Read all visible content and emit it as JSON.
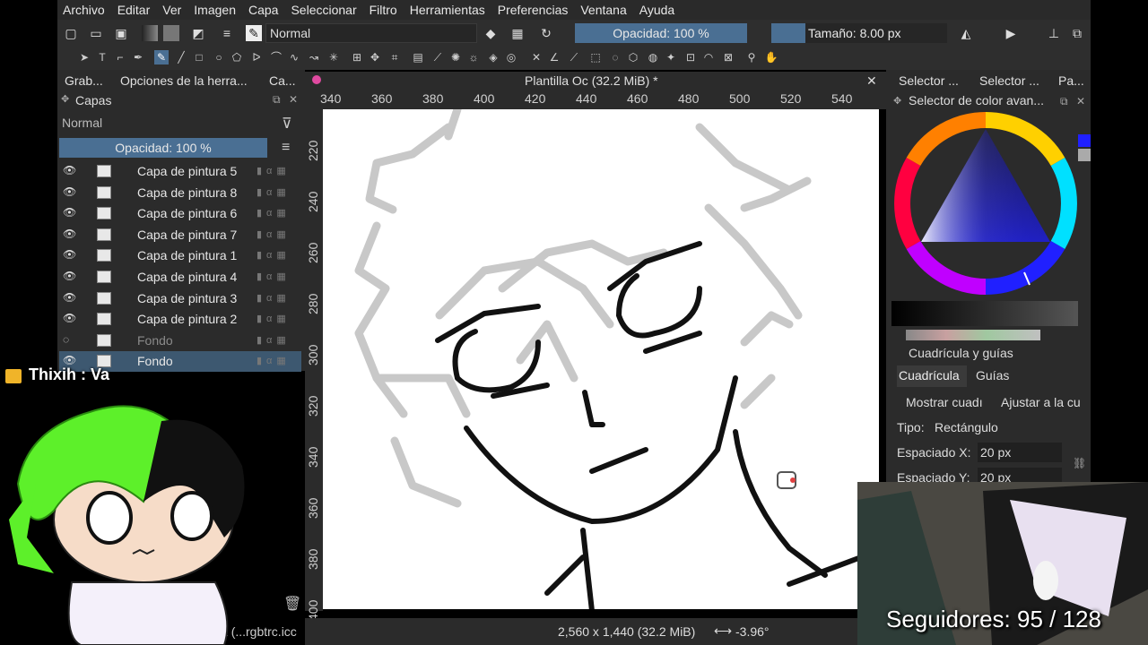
{
  "menu": [
    "Archivo",
    "Editar",
    "Ver",
    "Imagen",
    "Capa",
    "Seleccionar",
    "Filtro",
    "Herramientas",
    "Preferencias",
    "Ventana",
    "Ayuda"
  ],
  "toolbar": {
    "blend_mode": "Normal",
    "opacity": "Opacidad: 100 %",
    "size": "Tamaño: 8.00 px"
  },
  "left_dock": {
    "tabs": [
      "Grab...",
      "Opciones de la herra...",
      "Ca..."
    ],
    "layers_title": "Capas",
    "blend_mode": "Normal",
    "opacity": "Opacidad:  100 %",
    "layers": [
      {
        "name": "Capa de pintura 5",
        "visible": true
      },
      {
        "name": "Capa de pintura 8",
        "visible": true
      },
      {
        "name": "Capa de pintura 6",
        "visible": true
      },
      {
        "name": "Capa de pintura 7",
        "visible": true
      },
      {
        "name": "Capa de pintura 1",
        "visible": true
      },
      {
        "name": "Capa de pintura 4",
        "visible": true
      },
      {
        "name": "Capa de pintura 3",
        "visible": true
      },
      {
        "name": "Capa de pintura 2",
        "visible": true
      },
      {
        "name": "Fondo",
        "visible": false
      },
      {
        "name": "Fondo",
        "visible": true,
        "selected": true
      }
    ]
  },
  "canvas": {
    "title": "Plantilla Oc (32.2 MiB) *",
    "ruler_top": [
      "340",
      "360",
      "380",
      "400",
      "420",
      "440",
      "460",
      "480",
      "500",
      "520",
      "540"
    ],
    "ruler_left": [
      "220",
      "240",
      "260",
      "280",
      "300",
      "320",
      "340",
      "360",
      "380",
      "400"
    ]
  },
  "status": {
    "profile": "B/alfa (...rgbtrc.icc",
    "dimensions": "2,560 x 1,440 (32.2 MiB)",
    "rotation": "-3.96°"
  },
  "right_dock": {
    "tabs": [
      "Selector ...",
      "Selector ...",
      "Pa..."
    ],
    "advanced_color_title": "Selector de color avan...",
    "grid_title": "Cuadrícula y guías",
    "grid_tabs": [
      "Cuadrícula",
      "Guías"
    ],
    "show_grid": "Mostrar cuadı",
    "snap_grid": "Ajustar a la cu",
    "type_label": "Tipo:",
    "type_value": "Rectángulo",
    "spacing_x_label": "Espaciado X:",
    "spacing_x_value": "20 px",
    "spacing_y_label": "Espaciado Y:",
    "spacing_y_value": "20 px"
  },
  "overlay": {
    "chat_user": "Thixih",
    "chat_message": " : Va",
    "followers": "Seguidores: 95 / 128"
  },
  "colors": {
    "panel_bg": "#2b2b2b",
    "accent_blue": "#4a6f93",
    "selected_row": "#3d5870"
  }
}
